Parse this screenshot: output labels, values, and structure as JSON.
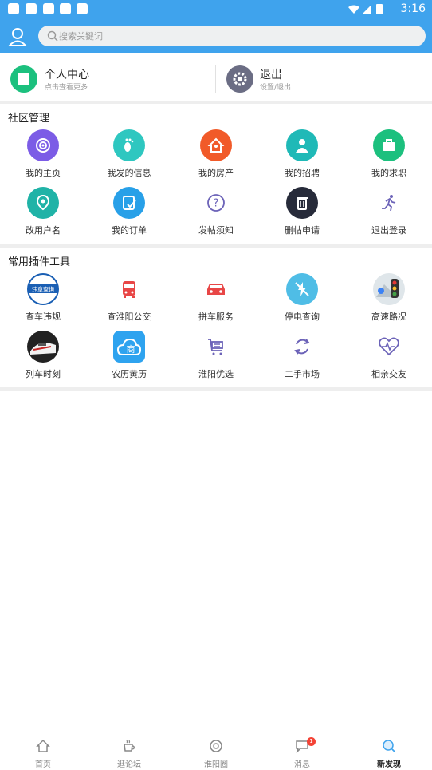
{
  "status_bar": {
    "time": "3:16"
  },
  "search": {
    "placeholder": "搜索关键词"
  },
  "header": {
    "personal": {
      "title": "个人中心",
      "subtitle": "点击查看更多"
    },
    "logout": {
      "title": "退出",
      "subtitle": "设置/退出"
    }
  },
  "community": {
    "title": "社区管理",
    "items": [
      {
        "label": "我的主页",
        "icon": "podcast-icon",
        "color": "#7c5ce6"
      },
      {
        "label": "我发的信息",
        "icon": "footprint-icon",
        "color": "#2ec7c0"
      },
      {
        "label": "我的房产",
        "icon": "house-icon",
        "color": "#f15a29"
      },
      {
        "label": "我的招聘",
        "icon": "recruit-icon",
        "color": "#1fb9b7"
      },
      {
        "label": "我的求职",
        "icon": "briefcase-icon",
        "color": "#1cc07e"
      },
      {
        "label": "改用户名",
        "icon": "location-icon",
        "color": "#20b3a7"
      },
      {
        "label": "我的订单",
        "icon": "order-icon",
        "color": "#28a0e8"
      },
      {
        "label": "发帖须知",
        "icon": "question-icon",
        "color": "#6c63b8"
      },
      {
        "label": "删帖申请",
        "icon": "trash-icon",
        "color": "#272b3a"
      },
      {
        "label": "退出登录",
        "icon": "running-icon",
        "color": "#6c63b8"
      }
    ]
  },
  "tools": {
    "title": "常用插件工具",
    "items": [
      {
        "label": "查车违规",
        "icon": "traffic-violation-icon",
        "color": "#1a5fb4"
      },
      {
        "label": "查淮阳公交",
        "icon": "bus-icon",
        "color": "#e84646"
      },
      {
        "label": "拼车服务",
        "icon": "car-icon",
        "color": "#e84646"
      },
      {
        "label": "停电查询",
        "icon": "power-outage-icon",
        "color": "#4fbde6"
      },
      {
        "label": "高速路况",
        "icon": "traffic-light-icon",
        "color": "#555555"
      },
      {
        "label": "列车时刻",
        "icon": "train-icon",
        "color": "#222222"
      },
      {
        "label": "农历黄历",
        "icon": "cloud-calendar-icon",
        "color": "#2ea3ef"
      },
      {
        "label": "淮阳优选",
        "icon": "cart-icon",
        "color": "#6c63b8"
      },
      {
        "label": "二手市场",
        "icon": "recycle-icon",
        "color": "#6c63b8"
      },
      {
        "label": "相亲交友",
        "icon": "heart-pulse-icon",
        "color": "#6c63b8"
      }
    ],
    "tile_text": {
      "violation": "违章查询",
      "calendar": "商"
    }
  },
  "tab_bar": {
    "tabs": [
      {
        "label": "首页",
        "icon": "home-icon"
      },
      {
        "label": "逛论坛",
        "icon": "coffee-icon"
      },
      {
        "label": "淮阳圈",
        "icon": "circle-icon"
      },
      {
        "label": "消息",
        "icon": "message-icon",
        "badge": "1"
      },
      {
        "label": "新发现",
        "icon": "discover-icon",
        "active": true
      }
    ]
  }
}
